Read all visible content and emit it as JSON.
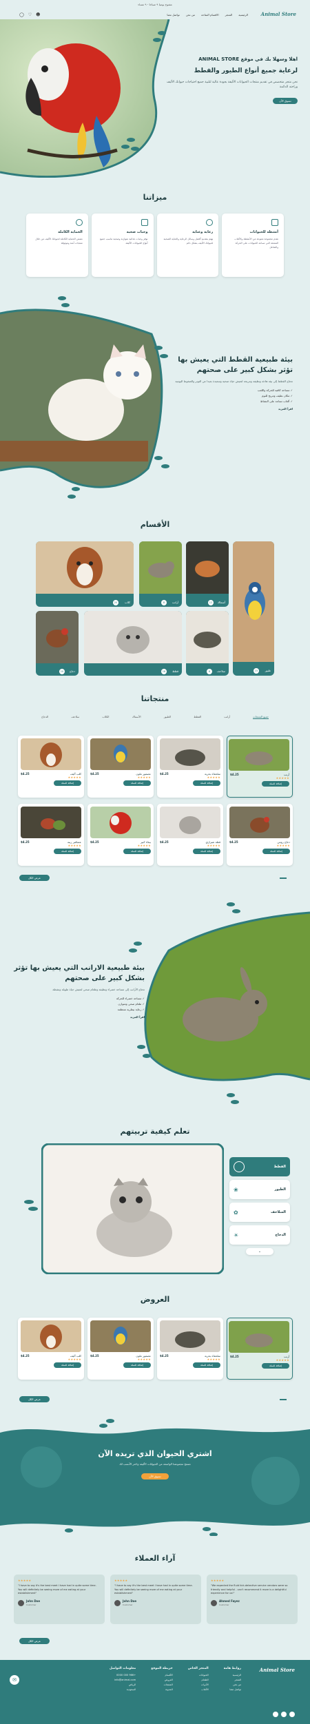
{
  "topbar": {
    "text": "مفتوح يوميا ٩ صباحا - ٩ مساء"
  },
  "nav": {
    "logo": "Animal Store",
    "links": [
      "الرئيسية",
      "المتجر",
      "الاقسام المتاحة",
      "من نحن",
      "تواصل معنا"
    ]
  },
  "hero": {
    "kicker": "اهلا وسهلا بك في موقع",
    "brand": "ANIMAL STORE",
    "title": "لرعاية جميع أنواع الطيور والقطط",
    "desc": "نحن متجر متخصص في تقديم منتجات الحيوانات الأليفة بجودة عالية لتلبية جميع احتياجات حيوانك الأليف وراحته الدائمة",
    "button": "تسوق الآن"
  },
  "features": {
    "title": "ميزاتنا",
    "items": [
      {
        "title": "أنشطة للحيوانات",
        "text": "نقدم مجموعة متنوعة من الأنشطة والألعاب الممتعة التي تساعد الحيوانات على الحركة والتفاعل"
      },
      {
        "title": "رعاية وعناية",
        "text": "نهتم بتقديم أفضل وسائل الرعاية والعناية الصحية لحيوانك الأليف بشكل دائم"
      },
      {
        "title": "وجبات صحية",
        "text": "نوفر وجبات غذائية متوازنة وصحية تناسب جميع أنواع الحيوانات الأليفة"
      },
      {
        "title": "الحماية الكاملة",
        "text": "نضمن الحماية الكاملة لحيوانك الأليف من خلال منتجات آمنة وموثوقة"
      }
    ]
  },
  "cats_block": {
    "title": "بيئة طبيعية القطط التي يعيش بها تؤثر بشكل كبير على صحتهم",
    "text": "تحتاج القطط إلى بيئة هادئة ونظيفة ومريحة لتعيش حياة صحية وسعيدة بعيدا عن التوتر والضغوط اليومية",
    "bullets": [
      "مساحة كافية للحركة واللعب",
      "مكان نظيف ومريح للنوم",
      "ألعاب تساعد على النشاط"
    ],
    "more": "اقرأ المزيد"
  },
  "categories": {
    "title": "الأقسام",
    "items": [
      {
        "name": "طيور",
        "count": "15"
      },
      {
        "name": "أسماك",
        "count": "12"
      },
      {
        "name": "أرانب",
        "count": "8"
      },
      {
        "name": "كلاب",
        "count": "20"
      },
      {
        "name": "سلاحف",
        "count": "6"
      },
      {
        "name": "قطط",
        "count": "18"
      },
      {
        "name": "دجاج",
        "count": "10"
      }
    ]
  },
  "products": {
    "title": "منتجاتنا",
    "tabs": [
      "جميع المنتجات",
      "أرانب",
      "القطط",
      "الطيور",
      "الأسماك",
      "الكلاب",
      "سلاحف",
      "الدجاج"
    ],
    "cart": "إضافة للسلة",
    "more": "عرض الكل",
    "items": [
      {
        "name": "أرنب",
        "price": "$4.25"
      },
      {
        "name": "سلحفاة بحرية",
        "price": "$4.25"
      },
      {
        "name": "عصفور ملون",
        "price": "$4.25"
      },
      {
        "name": "كلب أليف",
        "price": "$4.25"
      },
      {
        "name": "دجاج رومي",
        "price": "$4.25"
      },
      {
        "name": "قطة شيرازي",
        "price": "$4.25"
      },
      {
        "name": "ببغاء كبير",
        "price": "$4.25"
      },
      {
        "name": "عصافير زينة",
        "price": "$4.25"
      }
    ]
  },
  "rabbits_block": {
    "title": "بيئة طبيعية الارانب التي يعيش بها تؤثر بشكل كبير على صحتهم",
    "text": "تحتاج الأرانب إلى مساحة خضراء ونظيفة وطعام صحي لتعيش حياة طويلة ونشطة",
    "bullets": [
      "مساحة خضراء للحركة",
      "طعام صحي ومتوازن",
      "رعاية بيطرية منتظمة"
    ],
    "more": "اقرأ المزيد"
  },
  "learn": {
    "title": "تعلم كيفية تربيتهم",
    "items": [
      "القطط",
      "الطيور",
      "السلاحف",
      "الدجاج"
    ]
  },
  "offers": {
    "title": "العروض",
    "cart": "إضافة للسلة",
    "more": "عرض الكل",
    "items": [
      {
        "name": "أرنب",
        "price": "$4.25"
      },
      {
        "name": "سلحفاة بحرية",
        "price": "$4.25"
      },
      {
        "name": "عصفور ملون",
        "price": "$4.25"
      },
      {
        "name": "كلب أليف",
        "price": "$4.25"
      }
    ]
  },
  "cta": {
    "title": "اشتري الحيوان الذي تريده الآن",
    "text": "تصفح مجموعتنا الواسعة من الحيوانات الأليفة واختر الأنسب لك",
    "button": "تسوق الآن"
  },
  "reviews": {
    "title": "آراء العملاء",
    "more": "عرض الكل",
    "items": [
      {
        "text": "\"We expected the fluid tick-detective service vendors were so friendly and helpful - can't recommend it more is a delightful experience for us!\"",
        "name": "Ahmed Fayez",
        "role": "Customer"
      },
      {
        "text": "\"I have to say it's the best meet I have had in quite some time. You will definitely be seeing more of me eating at your establishment\"",
        "name": "John Doe",
        "role": "Customer"
      },
      {
        "text": "\"I have to say it's the best meet I have had in quite some time. You will definitely be seeing more of me eating at your establishment\"",
        "name": "John Doe",
        "role": "Customer"
      }
    ]
  },
  "footer": {
    "logo": "Animal Store",
    "cols": [
      {
        "title": "روابط هامة",
        "items": [
          "الرئيسية",
          "المتجر",
          "من نحن",
          "تواصل معنا"
        ]
      },
      {
        "title": "المتجر الخاص",
        "items": [
          "الحيوانات",
          "الطعام",
          "الأدوات",
          "الألعاب"
        ]
      },
      {
        "title": "خريطة الموقع",
        "items": [
          "الأقسام",
          "العروض",
          "المنتجات",
          "المدونة"
        ]
      },
      {
        "title": "معلومات التواصل",
        "items": [
          "+966 000 0000",
          "info@animal.com",
          "الرياض",
          "السعودية"
        ]
      }
    ]
  },
  "colors": {
    "primary": "#2f7c7c",
    "dark": "#1d3b3e",
    "bg": "#e3efef",
    "star": "#f2a23a"
  }
}
